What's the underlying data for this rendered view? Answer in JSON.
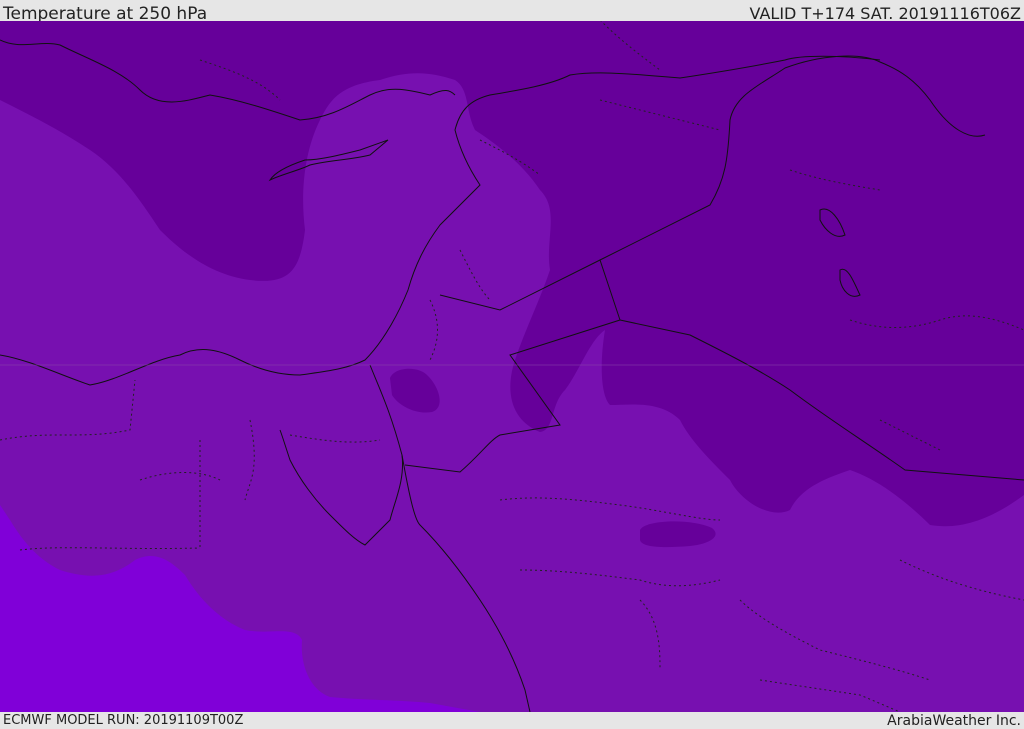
{
  "header": {
    "title": "Temperature at 250 hPa",
    "valid_time": "VALID T+174 SAT. 20191116T06Z"
  },
  "footer": {
    "model_run": "ECMWF MODEL RUN: 20191109T00Z",
    "credit": "ArabiaWeather Inc."
  },
  "colors": {
    "coldest_band": "#66009a",
    "cold_band": "#7710b0",
    "warm_band": "#8000d8",
    "border_line": "#111111",
    "bar_background": "#e6e6e6"
  }
}
